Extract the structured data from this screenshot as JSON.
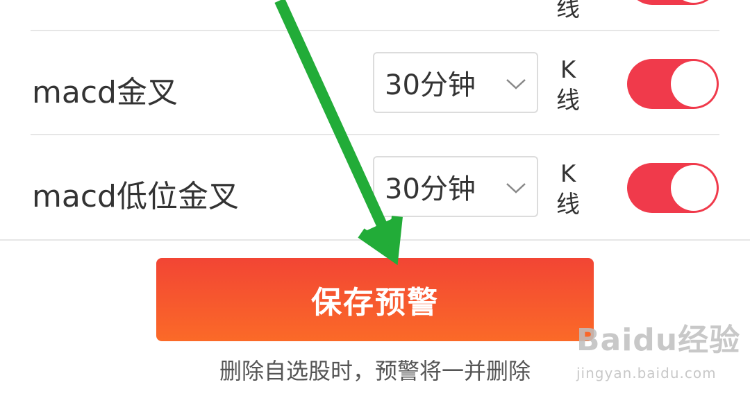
{
  "alerts": [
    {
      "label": "",
      "interval": "",
      "unit": "线",
      "enabled": true
    },
    {
      "label": "macd金叉",
      "interval": "30分钟",
      "unit_line1": "K",
      "unit_line2": "线",
      "enabled": true
    },
    {
      "label": "macd低位金叉",
      "interval": "30分钟",
      "unit_line1": "K",
      "unit_line2": "线",
      "enabled": true
    }
  ],
  "save_button_label": "保存预警",
  "hint_text": "删除自选股时，预警将一并删除",
  "watermark": {
    "logo": "Baidu经验",
    "url": "jingyan.baidu.com"
  },
  "colors": {
    "toggle_on": "#f03a4b",
    "button_top": "#f24534",
    "button_bottom": "#fb6a28",
    "arrow": "#22ac38"
  }
}
